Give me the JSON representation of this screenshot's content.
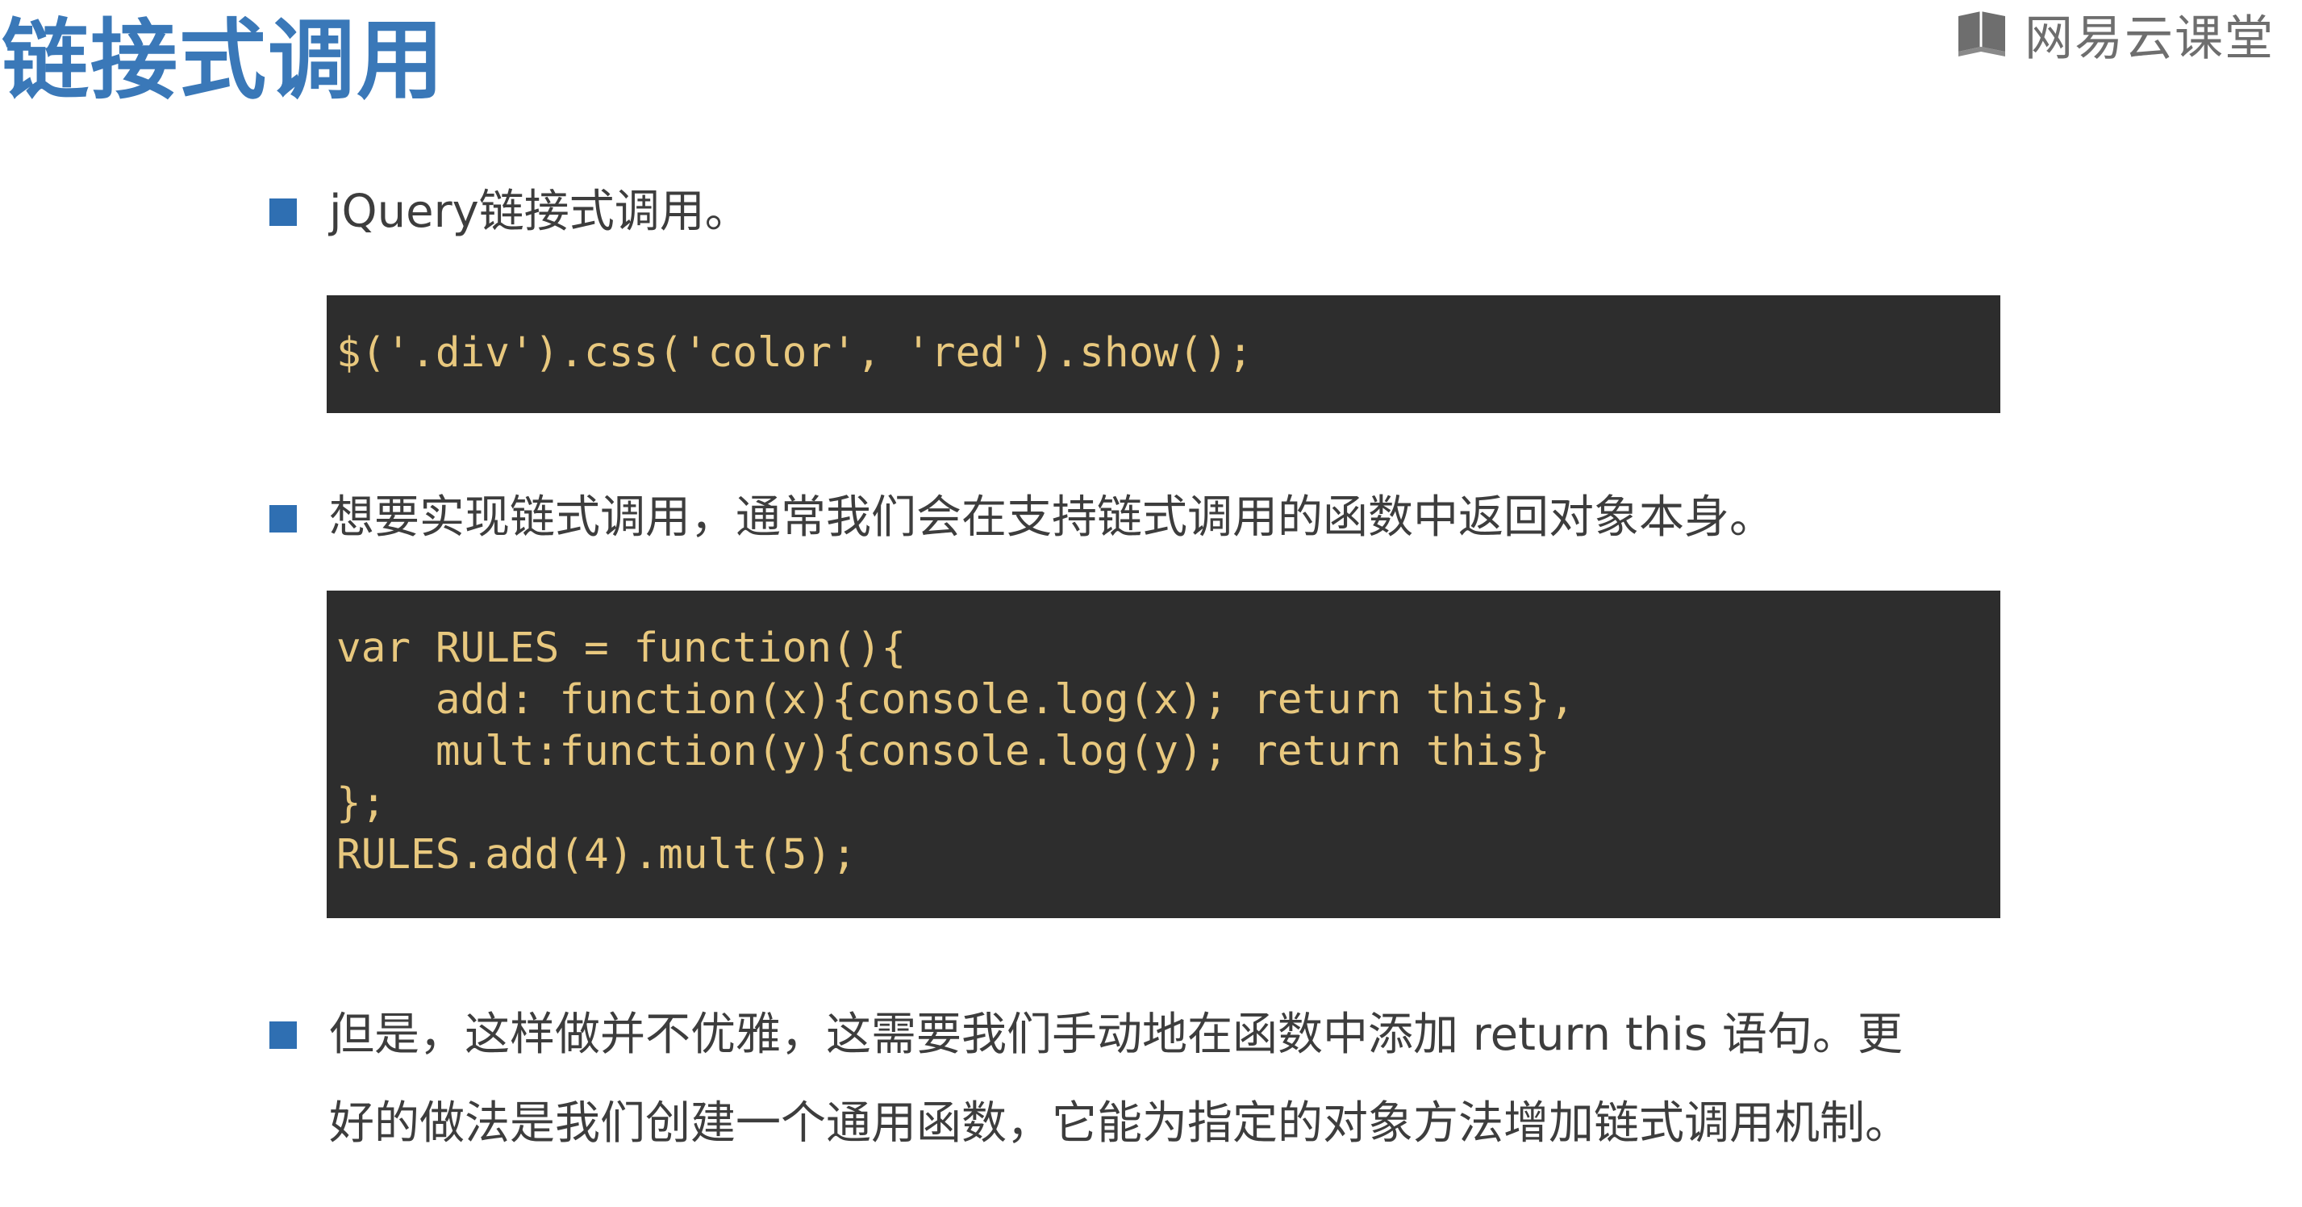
{
  "title": "链接式调用",
  "brand": {
    "icon": "book-icon",
    "text": "网易云课堂"
  },
  "colors": {
    "title": "#3a78b8",
    "bullet": "#2f6fb2",
    "code_background": "#2d2d2d",
    "code_text": "#e8c87e"
  },
  "sections": [
    {
      "text": "jQuery链接式调用。",
      "code": [
        "$('.div').css('color', 'red').show();"
      ]
    },
    {
      "text": "想要实现链式调用，通常我们会在支持链式调用的函数中返回对象本身。",
      "code": [
        "var RULES = function(){",
        "    add: function(x){console.log(x); return this},",
        "    mult:function(y){console.log(y); return this}",
        "};",
        "RULES.add(4).mult(5);"
      ]
    },
    {
      "text_lines": [
        "但是，这样做并不优雅，这需要我们手动地在函数中添加 return this 语句。更",
        "好的做法是我们创建一个通用函数，它能为指定的对象方法增加链式调用机制。"
      ]
    }
  ]
}
